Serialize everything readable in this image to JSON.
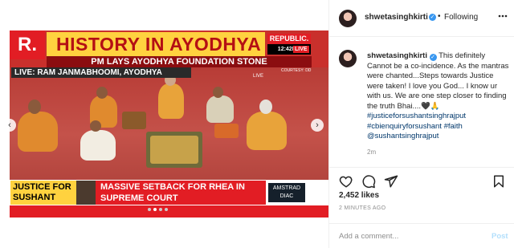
{
  "media": {
    "channel_logo": "R.",
    "headline": "HISTORY IN AYODHYA",
    "brand": "REPUBLIC.",
    "time": "12:42PM",
    "live_badge": "LIVE",
    "subhead": "PM LAYS AYODHYA FOUNDATION STONE",
    "live_location": "LIVE: RAM JANMABHOOMI, AYODHYA",
    "courtesy": "COURTESY: DD",
    "scene_live": "LIVE",
    "lower_left": "JUSTICE FOR SUSHANT",
    "lower_main": "MASSIVE SETBACK FOR RHEA IN SUPREME COURT",
    "sponsor": "AMSTRAD DIAC",
    "carousel_prev": "‹",
    "carousel_next": "›",
    "carousel_dots": 4,
    "carousel_active": 1
  },
  "header": {
    "username": "shwetasinghkirti",
    "verified": "✓",
    "separator": "•",
    "follow_state": "Following",
    "more_icon": "more-options-icon"
  },
  "caption": {
    "username": "shwetasinghkirti",
    "text": "This definitely Cannot be a co-incidence. As the mantras were chanted...Steps towards Justice were taken! I love you God... I know ur with us. We are one step closer to finding the truth Bhai....🖤🙏",
    "tags": "#justiceforsushantsinghrajput #cbienquiryforsushant #faith @sushantsinghrajput",
    "time_ago": "2m"
  },
  "actions": {
    "like_icon": "heart-icon",
    "comment_icon": "comment-icon",
    "share_icon": "share-icon",
    "save_icon": "bookmark-icon"
  },
  "likes": "2,452 likes",
  "posted": "2 MINUTES AGO",
  "comment": {
    "placeholder": "Add a comment...",
    "post_label": "Post"
  }
}
